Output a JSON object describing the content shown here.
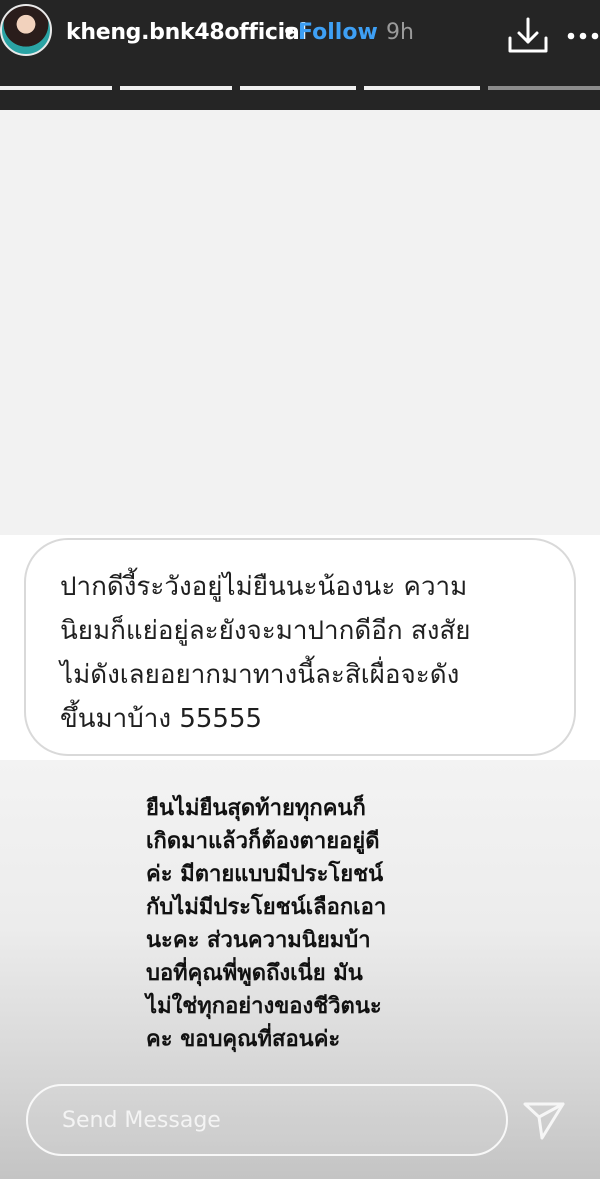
{
  "header": {
    "username": "kheng.bnk48official",
    "separator": "•",
    "follow_label": "Follow",
    "time": "9h",
    "icons": [
      "download-icon",
      "more-icon"
    ]
  },
  "story": {
    "progress_segments_total": 5,
    "current_segment_index": 4,
    "quoted_message": {
      "lines": [
        "ปากดีงี้ระวังอยู่ไม่ยืนนะน้องนะ ความ",
        "นิยมก็แย่อยู่ละยังจะมาปากดีอีก สงสัย",
        "ไม่ดังเลยอยากมาทางนี้ละสิเผื่อจะดัง",
        "ขึ้นมาบ้าง 55555"
      ]
    },
    "reply_text": {
      "lines": [
        "ยืนไม่ยืนสุดท้ายทุกคนก็",
        "เกิดมาแล้วก็ต้องตายอยู่ดี",
        "ค่ะ มีตายแบบมีประโยชน์",
        "กับไม่มีประโยชน์เลือกเอา",
        "นะคะ ส่วนความนิยมบ้า",
        "บอที่คุณพี่พูดถึงเนี่ย มัน",
        "ไม่ใช่ทุกอย่างของชีวิตนะ",
        "คะ ขอบคุณที่สอนค่ะ"
      ]
    }
  },
  "footer": {
    "send_placeholder": "Send Message",
    "send_icon": "send-icon"
  },
  "colors": {
    "header_bg": "#252525",
    "follow": "#3ea0f5"
  }
}
